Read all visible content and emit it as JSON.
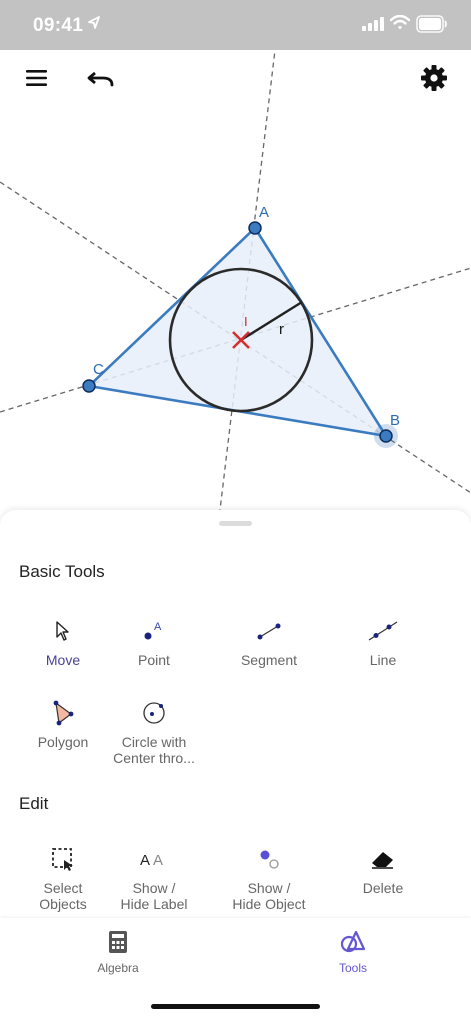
{
  "status_bar": {
    "time": "09:41"
  },
  "toolbar": {
    "menu_icon": "hamburger-menu-icon",
    "undo_icon": "undo-icon",
    "settings_icon": "gear-icon"
  },
  "construction": {
    "points": [
      "A",
      "B",
      "C"
    ],
    "incenter_label": "I",
    "radius_label": "r",
    "triangle_color": "#2b6cb0",
    "fill_color": "#e8eef9",
    "incenter_color": "#d32f2f"
  },
  "tools_panel": {
    "basic_title": "Basic Tools",
    "basic_tools": [
      {
        "label": "Move",
        "icon": "cursor-arrow-icon",
        "active": true
      },
      {
        "label": "Point",
        "icon": "point-icon"
      },
      {
        "label": "Segment",
        "icon": "segment-icon"
      },
      {
        "label": "Line",
        "icon": "line-icon"
      },
      {
        "label": "Polygon",
        "icon": "polygon-icon"
      },
      {
        "label": "Circle with\nCenter thro...",
        "icon": "circle-center-point-icon"
      }
    ],
    "edit_title": "Edit",
    "edit_tools": [
      {
        "label": "Select\nObjects",
        "icon": "select-objects-icon"
      },
      {
        "label": "Show /\nHide Label",
        "icon": "show-hide-label-icon"
      },
      {
        "label": "Show /\nHide Object",
        "icon": "show-hide-object-icon"
      },
      {
        "label": "Delete",
        "icon": "eraser-icon"
      }
    ]
  },
  "bottom_nav": {
    "tabs": [
      {
        "label": "Algebra",
        "icon": "calculator-icon"
      },
      {
        "label": "Tools",
        "icon": "shapes-icon",
        "active": true
      }
    ],
    "accent": "#6557d2"
  }
}
